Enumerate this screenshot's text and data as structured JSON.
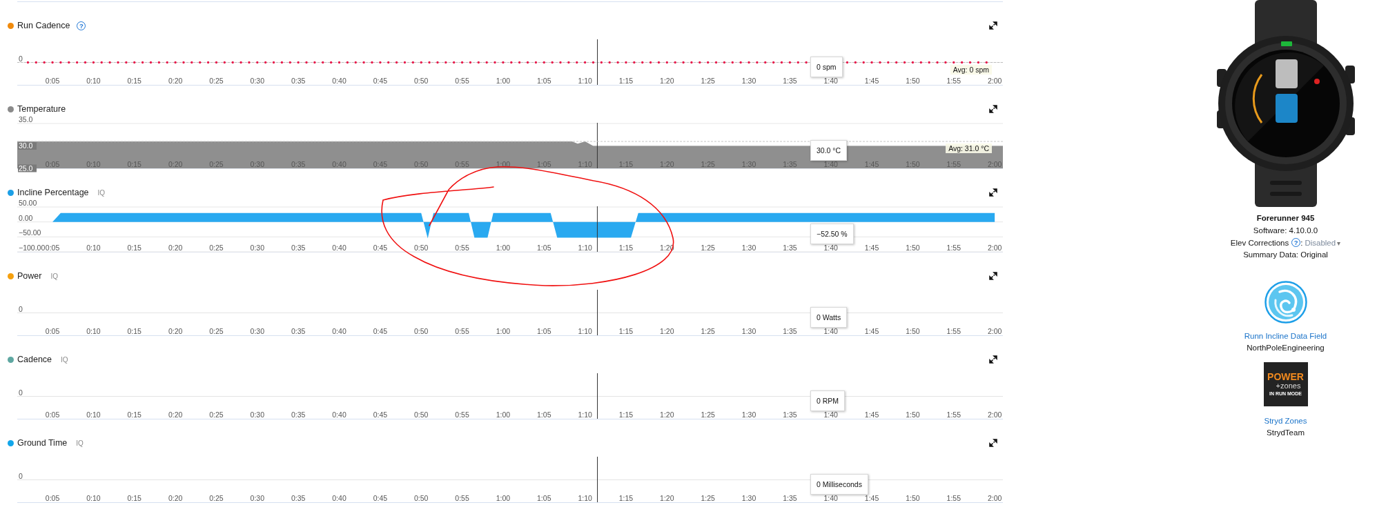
{
  "panels": [
    {
      "title": "Run Cadence",
      "color": "#f08a0c",
      "help": "?",
      "readout": "0 spm",
      "average": "Avg: 0 spm",
      "trace": {
        "kind": "dots"
      },
      "y_labels": [
        "0"
      ],
      "axis_labels": [
        "0:05",
        "0:10",
        "0:15",
        "0:20",
        "0:25",
        "0:30",
        "0:35",
        "0:40",
        "0:45",
        "0:50",
        "0:55",
        "1:00",
        "1:05",
        "1:10",
        "1:15",
        "1:20",
        "1:25",
        "1:30",
        "1:35",
        "1:40",
        "1:45",
        "1:50",
        "1:55",
        "2:00"
      ]
    },
    {
      "title": "Temperature",
      "color": "#8a8a8a",
      "readout": "30.0 °C",
      "chart_data": {
        "type": "area",
        "xlim": [
          0.7,
          121
        ],
        "ylim": [
          25,
          35
        ],
        "yticks": [
          {
            "value": 35,
            "label": "35.0"
          },
          {
            "value": 30,
            "label": "30.0"
          },
          {
            "value": 25,
            "label": "25.0"
          }
        ],
        "xticks": [
          {
            "value": 5,
            "label": "0:05"
          },
          {
            "value": 10,
            "label": "0:10"
          },
          {
            "value": 15,
            "label": "0:15"
          },
          {
            "value": 20,
            "label": "0:20"
          },
          {
            "value": 25,
            "label": "0:25"
          },
          {
            "value": 30,
            "label": "0:30"
          },
          {
            "value": 35,
            "label": "0:35"
          },
          {
            "value": 40,
            "label": "0:40"
          },
          {
            "value": 45,
            "label": "0:45"
          },
          {
            "value": 50,
            "label": "0:50"
          },
          {
            "value": 55,
            "label": "0:55"
          },
          {
            "value": 60,
            "label": "1:00"
          },
          {
            "value": 65,
            "label": "1:05"
          },
          {
            "value": 70,
            "label": "1:10"
          },
          {
            "value": 75,
            "label": "1:15"
          },
          {
            "value": 80,
            "label": "1:20"
          },
          {
            "value": 85,
            "label": "1:25"
          },
          {
            "value": 90,
            "label": "1:30"
          },
          {
            "value": 95,
            "label": "1:35"
          },
          {
            "value": 100,
            "label": "1:40"
          },
          {
            "value": 105,
            "label": "1:45"
          },
          {
            "value": 110,
            "label": "1:50"
          },
          {
            "value": 115,
            "label": "1:55"
          },
          {
            "value": 120,
            "label": "2:00"
          }
        ],
        "x": [
          0.7,
          68.4,
          69.1,
          70,
          71,
          121
        ],
        "series": [
          {
            "color": "#8f8f8f",
            "values": [
              31,
              31,
              30.5,
              31,
              30,
              30
            ]
          }
        ],
        "ref_lines": [
          {
            "axis": "x",
            "value": 71.5
          },
          {
            "label": "Avg: 31.0 °C"
          }
        ]
      }
    },
    {
      "title": "Incline Percentage",
      "color": "#1c9fe6",
      "tag": "IQ",
      "readout": "−52.50 %",
      "chart_data": {
        "type": "area",
        "xlim": [
          0.7,
          121
        ],
        "ylim": [
          -100,
          50
        ],
        "yticks": [
          {
            "value": 50,
            "label": "50.00"
          },
          {
            "value": 0,
            "label": "0.00"
          },
          {
            "value": -50,
            "label": "−50.00"
          },
          {
            "value": -100,
            "label": "−100.00"
          }
        ],
        "xticks": [
          {
            "value": 5,
            "label": "0:05"
          },
          {
            "value": 10,
            "label": "0:10"
          },
          {
            "value": 15,
            "label": "0:15"
          },
          {
            "value": 20,
            "label": "0:20"
          },
          {
            "value": 25,
            "label": "0:25"
          },
          {
            "value": 30,
            "label": "0:30"
          },
          {
            "value": 35,
            "label": "0:35"
          },
          {
            "value": 40,
            "label": "0:40"
          },
          {
            "value": 45,
            "label": "0:45"
          },
          {
            "value": 50,
            "label": "0:50"
          },
          {
            "value": 55,
            "label": "0:55"
          },
          {
            "value": 60,
            "label": "1:00"
          },
          {
            "value": 65,
            "label": "1:05"
          },
          {
            "value": 70,
            "label": "1:10"
          },
          {
            "value": 75,
            "label": "1:15"
          },
          {
            "value": 80,
            "label": "1:20"
          },
          {
            "value": 85,
            "label": "1:25"
          },
          {
            "value": 90,
            "label": "1:30"
          },
          {
            "value": 95,
            "label": "1:35"
          },
          {
            "value": 100,
            "label": "1:40"
          },
          {
            "value": 105,
            "label": "1:45"
          },
          {
            "value": 110,
            "label": "1:50"
          },
          {
            "value": 115,
            "label": "1:55"
          },
          {
            "value": 120,
            "label": "2:00"
          }
        ],
        "x": [
          5,
          6,
          50,
          50.8,
          51.5,
          55.8,
          56.5,
          58.1,
          58.8,
          65.8,
          66.6,
          75.6,
          76.5,
          120
        ],
        "series": [
          {
            "color": "#29a9f0",
            "values": [
              0,
              30,
              30,
              -55,
              30,
              30,
              -52.5,
              -52.5,
              30,
              30,
              -52.5,
              -52.5,
              30,
              30
            ]
          }
        ],
        "ref_lines": [
          {
            "axis": "x",
            "value": 71.5
          }
        ]
      }
    },
    {
      "title": "Power",
      "color": "#f5a00e",
      "tag": "IQ",
      "readout": "0 Watts",
      "y_labels": [
        "0"
      ],
      "axis_labels": [
        "0:05",
        "0:10",
        "0:15",
        "0:20",
        "0:25",
        "0:30",
        "0:35",
        "0:40",
        "0:45",
        "0:50",
        "0:55",
        "1:00",
        "1:05",
        "1:10",
        "1:15",
        "1:20",
        "1:25",
        "1:30",
        "1:35",
        "1:40",
        "1:45",
        "1:50",
        "1:55",
        "2:00"
      ]
    },
    {
      "title": "Cadence",
      "color": "#5ea7a1",
      "tag": "IQ",
      "readout": "0 RPM",
      "y_labels": [
        "0"
      ],
      "axis_labels": [
        "0:05",
        "0:10",
        "0:15",
        "0:20",
        "0:25",
        "0:30",
        "0:35",
        "0:40",
        "0:45",
        "0:50",
        "0:55",
        "1:00",
        "1:05",
        "1:10",
        "1:15",
        "1:20",
        "1:25",
        "1:30",
        "1:35",
        "1:40",
        "1:45",
        "1:50",
        "1:55",
        "2:00"
      ]
    },
    {
      "title": "Ground Time",
      "color": "#12a6ea",
      "tag": "IQ",
      "readout": "0 Milliseconds",
      "y_labels": [
        "0"
      ],
      "axis_labels": [
        "0:05",
        "0:10",
        "0:15",
        "0:20",
        "0:25",
        "0:30",
        "0:35",
        "0:40",
        "0:45",
        "0:50",
        "0:55",
        "1:00",
        "1:05",
        "1:10",
        "1:15",
        "1:20",
        "1:25",
        "1:30",
        "1:35",
        "1:40",
        "1:45",
        "1:50",
        "1:55",
        "2:00"
      ]
    }
  ],
  "device": {
    "name": "Forerunner 945",
    "software": "Software: 4.10.0.0",
    "elev_label": "Elev Corrections",
    "elev_help": "?",
    "elev_separator": ":",
    "elev_value": "Disabled",
    "elev_caret": "▾",
    "summary": "Summary Data: Original"
  },
  "apps": [
    {
      "kind": "swirl",
      "name": "Runn Incline Data Field",
      "developer": "NorthPoleEngineering"
    },
    {
      "kind": "tile",
      "logo_lines": [
        "POWER",
        "+zones",
        "IN RUN MODE"
      ],
      "name": "Stryd Zones",
      "developer": "StrydTeam"
    }
  ],
  "markup": [
    {
      "kind": "freehand-circle"
    }
  ]
}
